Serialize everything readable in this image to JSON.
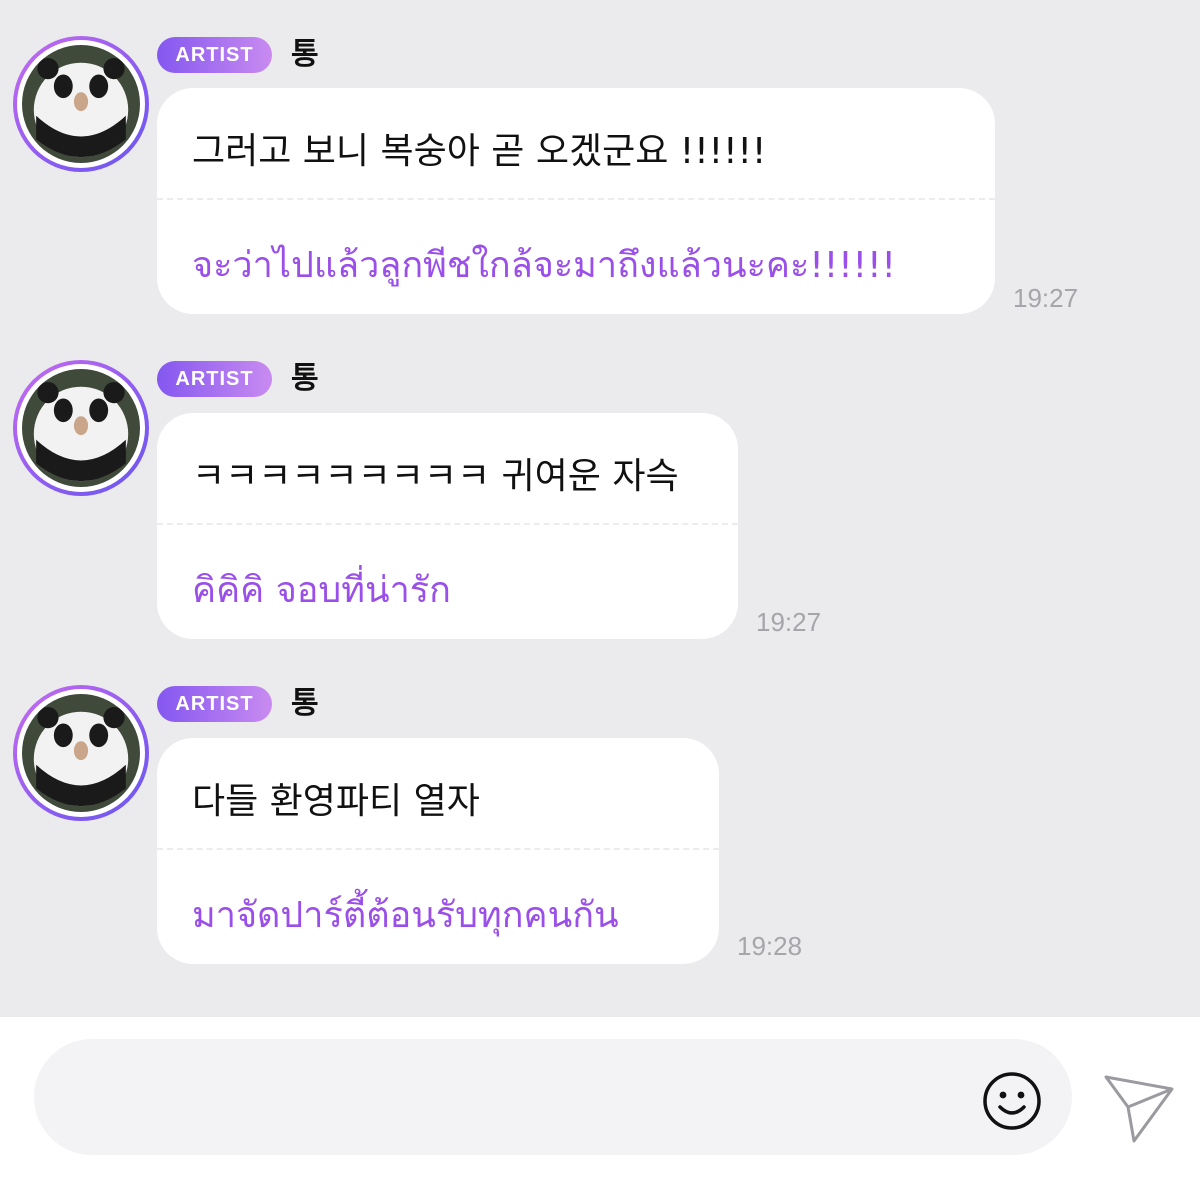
{
  "messages": [
    {
      "badge": "ARTIST",
      "name": "통",
      "original": "그러고 보니 복숭아 곧 오겠군요 !!!!!!",
      "translation": "จะว่าไปแล้วลูกพีชใกล้จะมาถึงแล้วนะคะ!!!!!!",
      "time": "19:27"
    },
    {
      "badge": "ARTIST",
      "name": "통",
      "original": "ㅋㅋㅋㅋㅋㅋㅋㅋㅋ 귀여운 자슥",
      "translation": "คิคิคิ จอบที่น่ารัก",
      "time": "19:27"
    },
    {
      "badge": "ARTIST",
      "name": "통",
      "original": "다들 환영파티 열자",
      "translation": "มาจัดปาร์ตี้ต้อนรับทุกคนกัน",
      "time": "19:28"
    }
  ],
  "composer": {
    "input_value": "",
    "emoji_icon": "smiley-icon",
    "send_icon": "paper-plane-icon"
  },
  "colors": {
    "background": "#ebebed",
    "bubble": "#ffffff",
    "translation_text": "#9a4fe8",
    "badge_start": "#8457f0",
    "badge_end": "#c98bf0",
    "time_text": "#a5a5aa"
  }
}
